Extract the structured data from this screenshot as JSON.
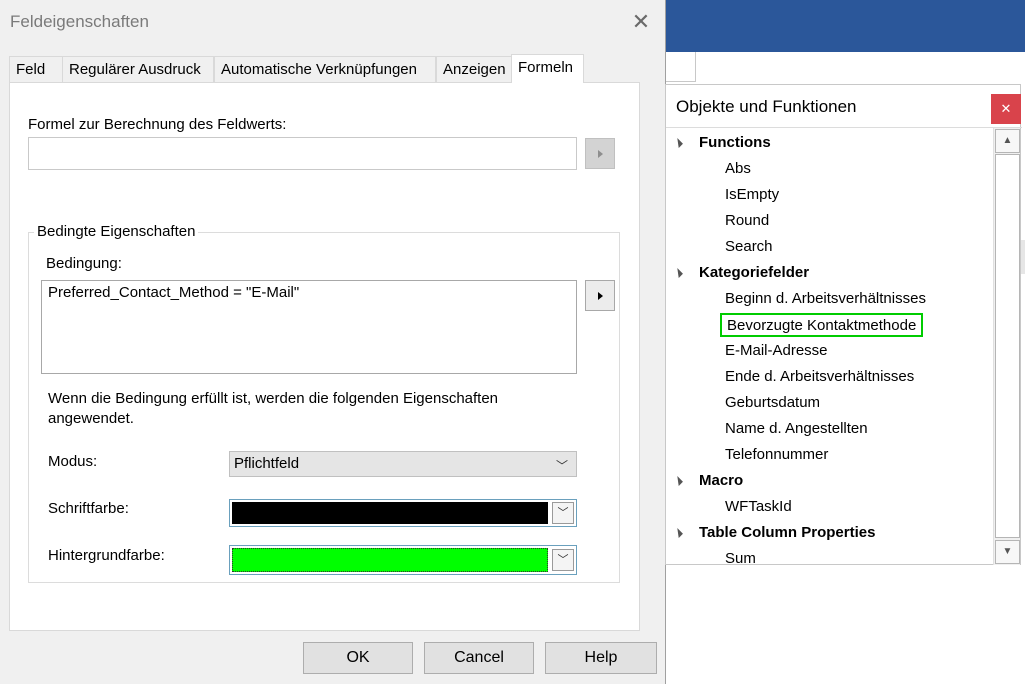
{
  "dialog": {
    "title": "Feldeigenschaften",
    "tabs": [
      {
        "label": "Feld"
      },
      {
        "label": "Regulärer Ausdruck"
      },
      {
        "label": "Automatische Verknüpfungen"
      },
      {
        "label": "Anzeigen"
      },
      {
        "label": "Formeln"
      }
    ],
    "active_tab": "Formeln",
    "formula_label": "Formel zur Berechnung des Feldwerts:",
    "formula_value": "",
    "conditional": {
      "legend": "Bedingte Eigenschaften",
      "condition_label": "Bedingung:",
      "condition_value": "Preferred_Contact_Method = \"E-Mail\"",
      "info_text": "Wenn die Bedingung erfüllt ist, werden die folgenden Eigenschaften angewendet.",
      "mode_label": "Modus:",
      "mode_value": "Pflichtfeld",
      "font_color_label": "Schriftfarbe:",
      "font_color": "#000000",
      "background_color_label": "Hintergrundfarbe:",
      "background_color": "#00ff00"
    },
    "buttons": {
      "ok": "OK",
      "cancel": "Cancel",
      "help": "Help"
    }
  },
  "objects_pane": {
    "title": "Objekte und Funktionen",
    "categories": [
      {
        "label": "Functions",
        "items": [
          "Abs",
          "IsEmpty",
          "Round",
          "Search"
        ]
      },
      {
        "label": "Kategoriefelder",
        "items": [
          "Beginn d. Arbeitsverhältnisses",
          "Bevorzugte Kontaktmethode",
          "E-Mail-Adresse",
          "Ende d. Arbeitsverhältnisses",
          "Geburtsdatum",
          "Name d. Angestellten",
          "Telefonnummer"
        ]
      },
      {
        "label": "Macro",
        "items": [
          "WFTaskId"
        ]
      },
      {
        "label": "Table Column Properties",
        "items": [
          "Sum"
        ]
      }
    ],
    "highlighted_item": "Bevorzugte Kontaktmethode"
  },
  "colors": {
    "accent_blue": "#2b579a",
    "close_red": "#d9434b",
    "highlight_green": "#00cc00"
  }
}
